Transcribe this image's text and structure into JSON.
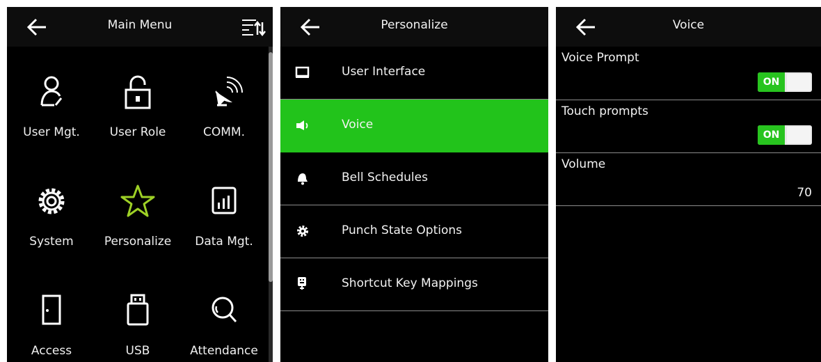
{
  "main_menu": {
    "title": "Main Menu",
    "items": [
      {
        "label": "User Mgt.",
        "icon": "user-icon"
      },
      {
        "label": "User Role",
        "icon": "lock-icon"
      },
      {
        "label": "COMM.",
        "icon": "satellite-dish-icon"
      },
      {
        "label": "System",
        "icon": "gear-icon"
      },
      {
        "label": "Personalize",
        "icon": "star-icon"
      },
      {
        "label": "Data Mgt.",
        "icon": "bar-chart-icon"
      },
      {
        "label": "Access",
        "icon": "door-icon"
      },
      {
        "label": "USB",
        "icon": "usb-icon"
      },
      {
        "label": "Attendance",
        "icon": "search-icon"
      }
    ]
  },
  "personalize": {
    "title": "Personalize",
    "items": [
      {
        "label": "User Interface",
        "icon": "monitor-icon"
      },
      {
        "label": "Voice",
        "icon": "speaker-icon"
      },
      {
        "label": "Bell Schedules",
        "icon": "bell-icon"
      },
      {
        "label": "Punch State Options",
        "icon": "gear-icon"
      },
      {
        "label": "Shortcut Key Mappings",
        "icon": "keypad-icon"
      }
    ],
    "active_item": "Voice"
  },
  "voice": {
    "title": "Voice",
    "voice_prompt": {
      "label": "Voice Prompt",
      "state": "ON"
    },
    "touch_prompts": {
      "label": "Touch prompts",
      "state": "ON"
    },
    "volume": {
      "label": "Volume",
      "value": "70"
    }
  },
  "colors": {
    "accent": "#22c31b",
    "background": "#000000",
    "divider": "#8c8c8c"
  }
}
